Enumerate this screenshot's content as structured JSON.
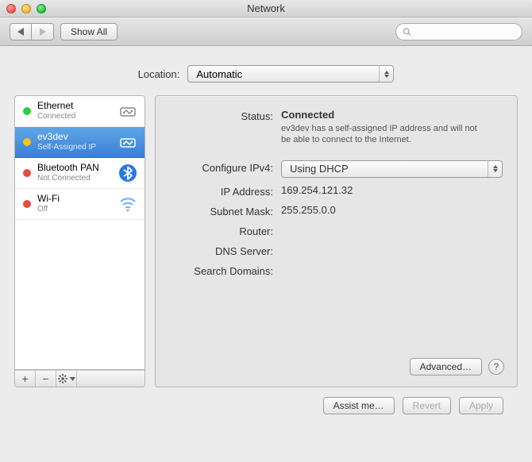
{
  "window": {
    "title": "Network"
  },
  "toolbar": {
    "show_all": "Show All",
    "search_placeholder": ""
  },
  "location": {
    "label": "Location:",
    "value": "Automatic"
  },
  "sidebar": {
    "items": [
      {
        "name": "Ethernet",
        "sub": "Connected",
        "dot": "#2ecc40",
        "icon": "ethernet",
        "selected": false
      },
      {
        "name": "ev3dev",
        "sub": "Self-Assigned IP",
        "dot": "#f5c518",
        "icon": "ethernet",
        "selected": true
      },
      {
        "name": "Bluetooth PAN",
        "sub": "Not Connected",
        "dot": "#e74c3c",
        "icon": "bluetooth",
        "selected": false
      },
      {
        "name": "Wi-Fi",
        "sub": "Off",
        "dot": "#e74c3c",
        "icon": "wifi",
        "selected": false
      }
    ]
  },
  "detail": {
    "status_label": "Status:",
    "status_value": "Connected",
    "status_desc": "ev3dev has a self-assigned IP address and will not be able to connect to the Internet.",
    "configure_label": "Configure IPv4:",
    "configure_value": "Using DHCP",
    "ip_label": "IP Address:",
    "ip_value": "169.254.121.32",
    "subnet_label": "Subnet Mask:",
    "subnet_value": "255.255.0.0",
    "router_label": "Router:",
    "router_value": "",
    "dns_label": "DNS Server:",
    "dns_value": "",
    "search_label": "Search Domains:",
    "search_value": "",
    "advanced": "Advanced…"
  },
  "footer_buttons": {
    "assist": "Assist me…",
    "revert": "Revert",
    "apply": "Apply"
  },
  "colors": {
    "selection": "#4a8fd8"
  }
}
